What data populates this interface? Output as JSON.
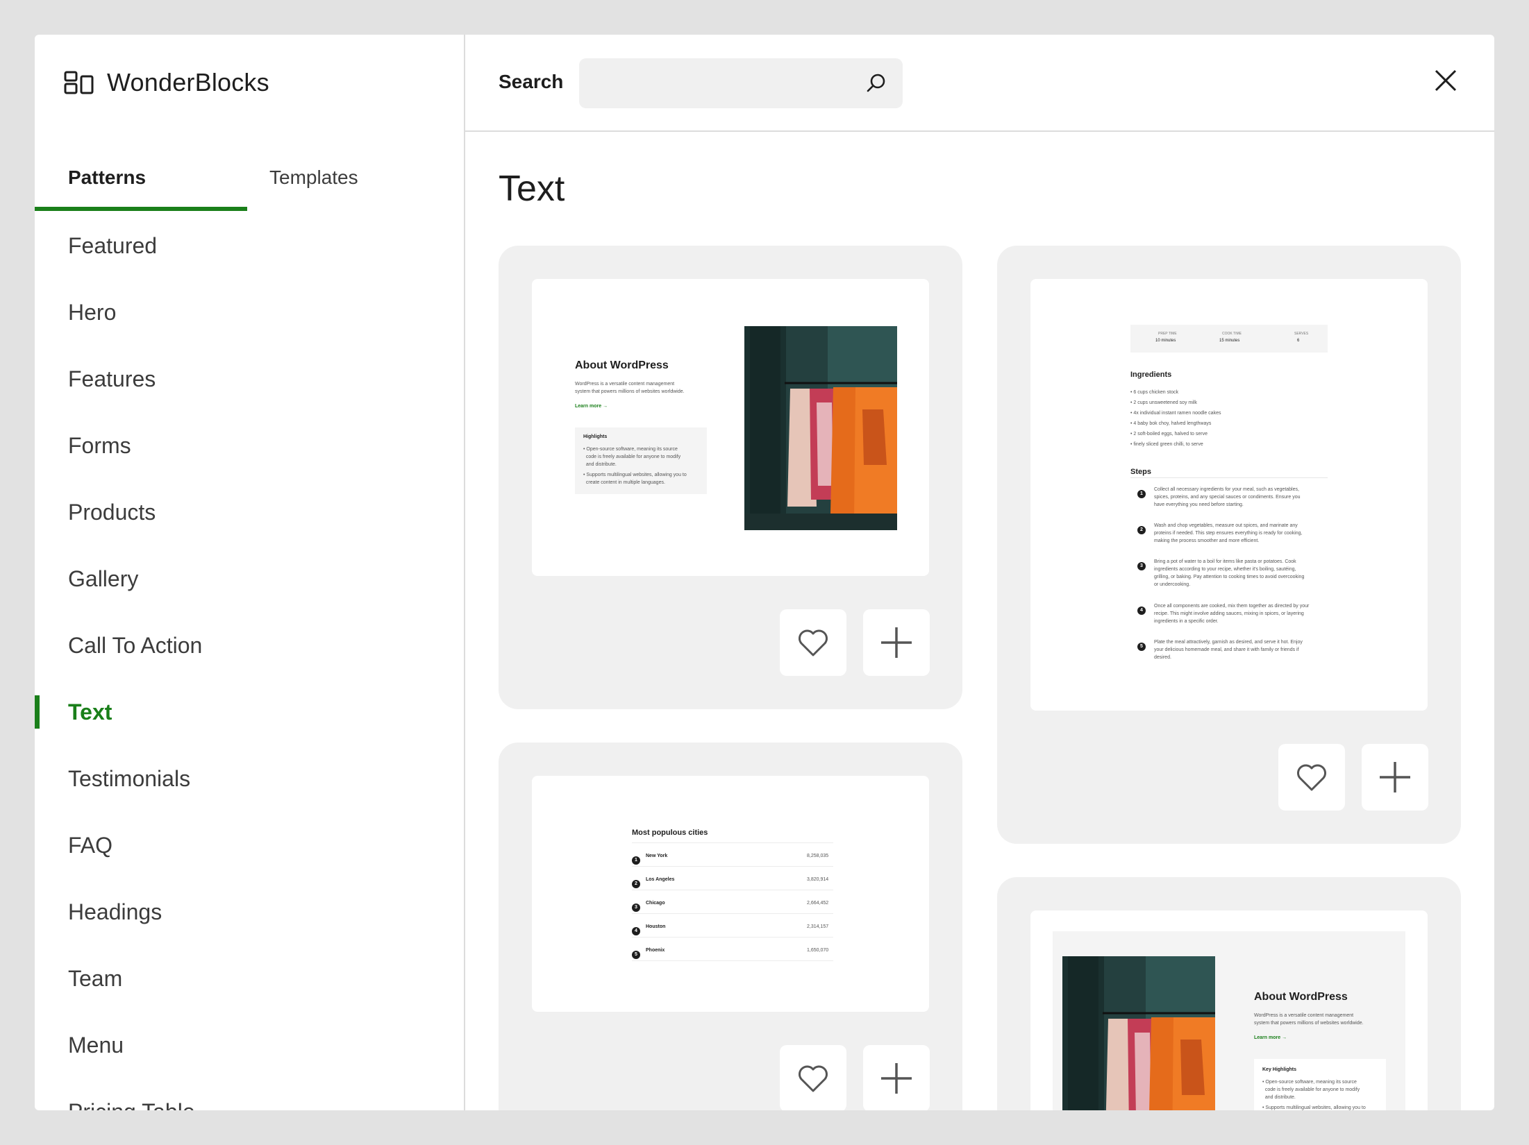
{
  "app": {
    "name": "WonderBlocks"
  },
  "tabs": [
    {
      "label": "Patterns",
      "active": true
    },
    {
      "label": "Templates",
      "active": false
    }
  ],
  "categories": [
    {
      "label": "Featured"
    },
    {
      "label": "Hero"
    },
    {
      "label": "Features"
    },
    {
      "label": "Forms"
    },
    {
      "label": "Products"
    },
    {
      "label": "Gallery"
    },
    {
      "label": "Call To Action"
    },
    {
      "label": "Text",
      "active": true
    },
    {
      "label": "Testimonials"
    },
    {
      "label": "FAQ"
    },
    {
      "label": "Headings"
    },
    {
      "label": "Team"
    },
    {
      "label": "Menu"
    },
    {
      "label": "Pricing Table"
    }
  ],
  "search": {
    "label": "Search",
    "value": "",
    "placeholder": ""
  },
  "section": {
    "title": "Text"
  },
  "colors": {
    "accent": "#1a7f1a",
    "card_bg": "#f0f0f0",
    "page_bg": "#e2e2e2"
  },
  "icons": {
    "logo": "layout-blocks-icon",
    "search": "search-icon",
    "close": "close-icon",
    "favorite": "heart-icon",
    "add": "plus-icon"
  },
  "patterns": {
    "about1": {
      "title": "About WordPress",
      "desc_1": "WordPress is a versatile content management",
      "desc_2": "system that powers millions of websites worldwide.",
      "link": "Learn more →",
      "highlights_title": "Highlights",
      "bullets": [
        "• Open-source software, meaning its source",
        "  code is freely available for anyone to modify",
        "  and distribute.",
        "• Supports multilingual websites, allowing you to",
        "  create content in multiple languages."
      ]
    },
    "recipe": {
      "stats": [
        {
          "label": "PREP TIME",
          "value": "10 minutes"
        },
        {
          "label": "COOK TIME",
          "value": "15 minutes"
        },
        {
          "label": "SERVES",
          "value": "6"
        }
      ],
      "ingredients_title": "Ingredients",
      "ingredients": [
        "• 6 cups chicken stock",
        "• 2 cups unsweetened soy milk",
        "• 4x individual instant ramen noodle cakes",
        "• 4 baby bok choy, halved lengthways",
        "• 2 soft-boiled eggs, halved to serve",
        "• finely sliced green chilli, to serve"
      ],
      "steps_title": "Steps",
      "steps": [
        {
          "n": "1",
          "lines": [
            "Collect all necessary ingredients for your meal, such as vegetables,",
            "spices, proteins, and any special sauces or condiments. Ensure you",
            "have everything you need before starting."
          ]
        },
        {
          "n": "2",
          "lines": [
            "Wash and chop vegetables, measure out spices, and marinate any",
            "proteins if needed. This step ensures everything is ready for cooking,",
            "making the process smoother and more efficient."
          ]
        },
        {
          "n": "3",
          "lines": [
            "Bring a pot of water to a boil for items like pasta or potatoes. Cook",
            "ingredients according to your recipe, whether it's boiling, sautéing,",
            "grilling, or baking. Pay attention to cooking times to avoid overcooking",
            "or undercooking."
          ]
        },
        {
          "n": "4",
          "lines": [
            "Once all components are cooked, mix them together as directed by your",
            "recipe. This might involve adding sauces, mixing in spices, or layering",
            "ingredients in a specific order."
          ]
        },
        {
          "n": "5",
          "lines": [
            "Plate the meal attractively, garnish as desired, and serve it hot. Enjoy",
            "your delicious homemade meal, and share it with family or friends if",
            "desired."
          ]
        }
      ]
    },
    "cities": {
      "title": "Most populous cities",
      "rows": [
        {
          "n": "1",
          "city": "New York",
          "pop": "8,258,035"
        },
        {
          "n": "2",
          "city": "Los Angeles",
          "pop": "3,820,914"
        },
        {
          "n": "3",
          "city": "Chicago",
          "pop": "2,664,452"
        },
        {
          "n": "4",
          "city": "Houston",
          "pop": "2,314,157"
        },
        {
          "n": "5",
          "city": "Phoenix",
          "pop": "1,650,070"
        }
      ]
    },
    "about2": {
      "title": "About WordPress",
      "desc_1": "WordPress is a versatile content management",
      "desc_2": "system that powers millions of websites worldwide.",
      "link": "Learn more →",
      "highlights_title": "Key Highlights",
      "bullets": [
        "• Open-source software, meaning its source",
        "  code is freely available for anyone to modify",
        "  and distribute.",
        "• Supports multilingual websites, allowing you to"
      ]
    }
  }
}
